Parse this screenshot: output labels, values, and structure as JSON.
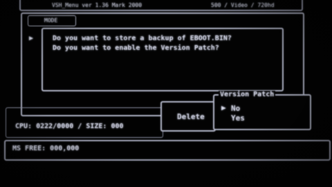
{
  "title_bar": {
    "title": "VSH_Menu ver 1.36 Mark 2000",
    "right_info": "500 / Video / 720hd"
  },
  "outer_window": {
    "header_label": "MODE"
  },
  "dialog": {
    "line1": "Do you want to store a backup of EBOOT.BIN?",
    "line2": "Do you want to enable the Version Patch?"
  },
  "status": {
    "clock_line": "CPU: 0222/0000 / SIZE: 000",
    "free_line": "MS FREE: 000,000"
  },
  "delete_button": {
    "label": "Delete"
  },
  "version_patch_menu": {
    "title": "Version Patch",
    "cursor_glyph": "▶",
    "options": [
      "No",
      "Yes"
    ],
    "selected": "No"
  }
}
